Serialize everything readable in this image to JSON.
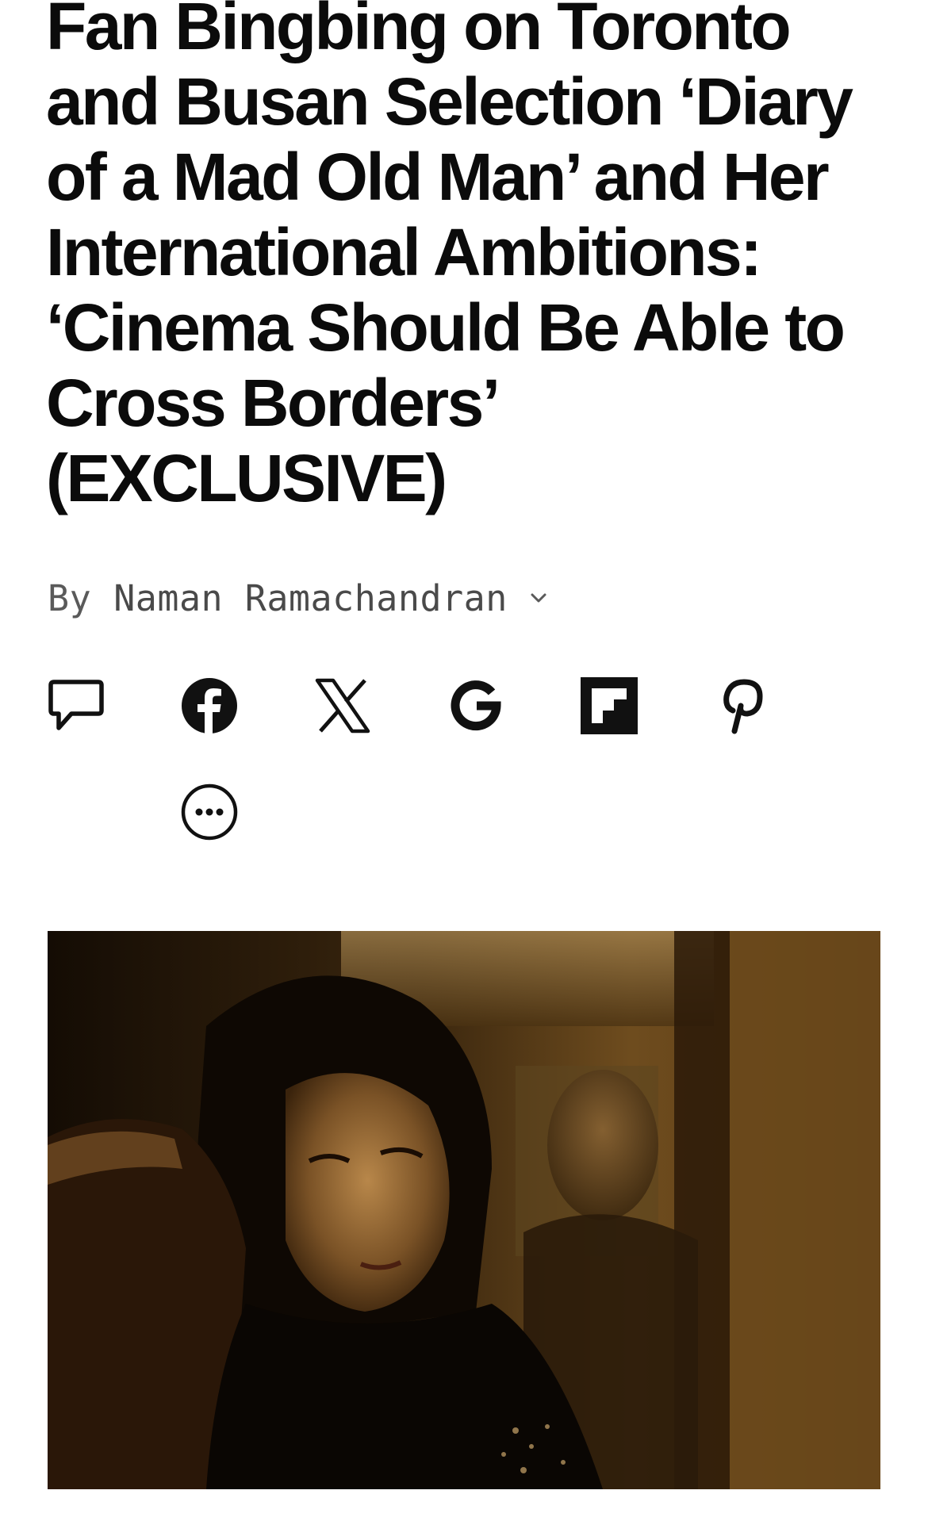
{
  "article": {
    "headline": "Fan Bingbing on Toronto and Busan Selection ‘Diary of a Mad Old Man’ and Her International Ambitions: ‘Cinema Should Be Able to Cross Borders’ (EXCLUSIVE)",
    "byline": {
      "prefix": "By",
      "author": "Naman Ramachandran"
    }
  },
  "share": {
    "icons": [
      "comment-icon",
      "facebook-icon",
      "x-icon",
      "google-icon",
      "flipboard-icon",
      "pinterest-icon",
      "more-icon"
    ]
  },
  "hero_image": {
    "subject": "film still of a woman in a dark dress, warm amber light"
  },
  "colors": {
    "text": "#0b0b0b",
    "byline": "#5a5a5a"
  }
}
